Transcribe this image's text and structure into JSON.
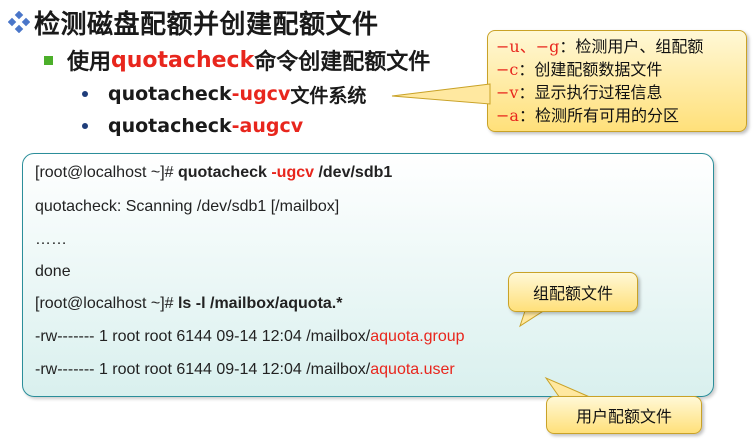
{
  "title": "检测磁盘配额并创建配额文件",
  "subtitle": {
    "prefix": "使用",
    "command": "quotacheck",
    "suffix": "命令创建配额文件"
  },
  "usages": [
    {
      "cmd": "quotacheck ",
      "flags": "-ugcv",
      "arg": " 文件系统"
    },
    {
      "cmd": "quotacheck ",
      "flags": "-augcv",
      "arg": ""
    }
  ],
  "options": [
    {
      "key": "−u、−g",
      "desc": "：检测用户、组配额"
    },
    {
      "key": "−c",
      "desc": "：创建配额数据文件"
    },
    {
      "key": "−v",
      "desc": "：显示执行过程信息"
    },
    {
      "key": "−a",
      "desc": "：检测所有可用的分区"
    }
  ],
  "terminal": {
    "line1": {
      "prompt": "[root@localhost ~]# ",
      "cmd": "quotacheck  ",
      "flags": "-ugcv",
      "arg": "  /dev/sdb1"
    },
    "line2": "quotacheck: Scanning /dev/sdb1 [/mailbox]",
    "line3": "……",
    "line4": "done",
    "line5": {
      "prompt": "[root@localhost ~]# ",
      "cmd": "ls -l /mailbox/aquota.*"
    },
    "line6": {
      "prefix": "-rw------- 1 root root 6144 09-14 12:04 /mailbox/",
      "file": "aquota.group"
    },
    "line7": {
      "prefix": "-rw------- 1 root root 6144 09-14 12:04 /mailbox/",
      "file": "aquota.user"
    }
  },
  "callouts": {
    "group_file": "组配额文件",
    "user_file": "用户配额文件"
  },
  "colors": {
    "accent_red": "#e8261d",
    "bullet_green": "#4caf2a",
    "callout_yellow": "#ffe07a",
    "terminal_border": "#2b8e9a"
  }
}
